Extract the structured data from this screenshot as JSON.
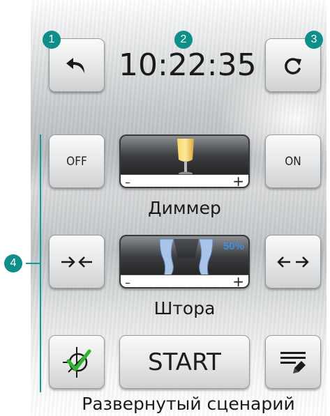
{
  "clock": {
    "time": "10:22:35"
  },
  "badges": {
    "b1": "1",
    "b2": "2",
    "b3": "3",
    "b4": "4"
  },
  "icons": {
    "back": "undo-arrow-icon",
    "refresh": "redo-arrow-icon",
    "close": "close-curtain-icon",
    "open": "open-curtain-icon",
    "scenario_disable": "scenario-toggle-icon",
    "scenario_list": "scenario-list-icon",
    "lamp": "lamp-icon",
    "curtain": "curtain-icon"
  },
  "dimmer": {
    "off_label": "OFF",
    "on_label": "ON",
    "minus": "–",
    "plus": "+",
    "caption": "Диммер"
  },
  "curtain": {
    "percent": "50%",
    "minus": "–",
    "plus": "+",
    "caption": "Штора",
    "level": 0.5
  },
  "scenario": {
    "start_label": "START",
    "caption": "Развернутый сценарий"
  },
  "colors": {
    "accent": "#0f8e8a",
    "percent": "#3d8fe0",
    "check": "#2db52d"
  }
}
